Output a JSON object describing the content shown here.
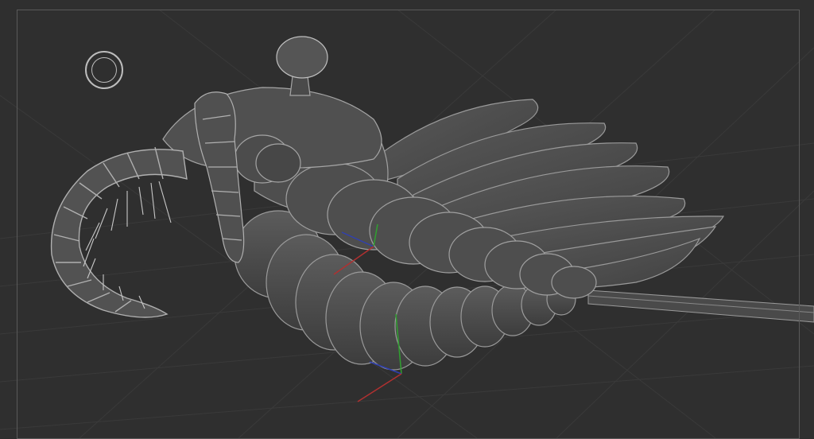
{
  "viewport": {
    "background_color": "#2f2f2f",
    "frame_color": "#5a5a5a",
    "grid_color": "#3a3a3a"
  },
  "model": {
    "subject": "anomalocaris-sculpt",
    "material_color": "#555555",
    "edge_color": "#9a9a9a"
  },
  "gizmo": {
    "x_axis_color": "#b03030",
    "y_axis_color": "#30a030",
    "z_axis_color": "#3040b0"
  },
  "navigation": {
    "icon": "orbit-circle-icon"
  }
}
